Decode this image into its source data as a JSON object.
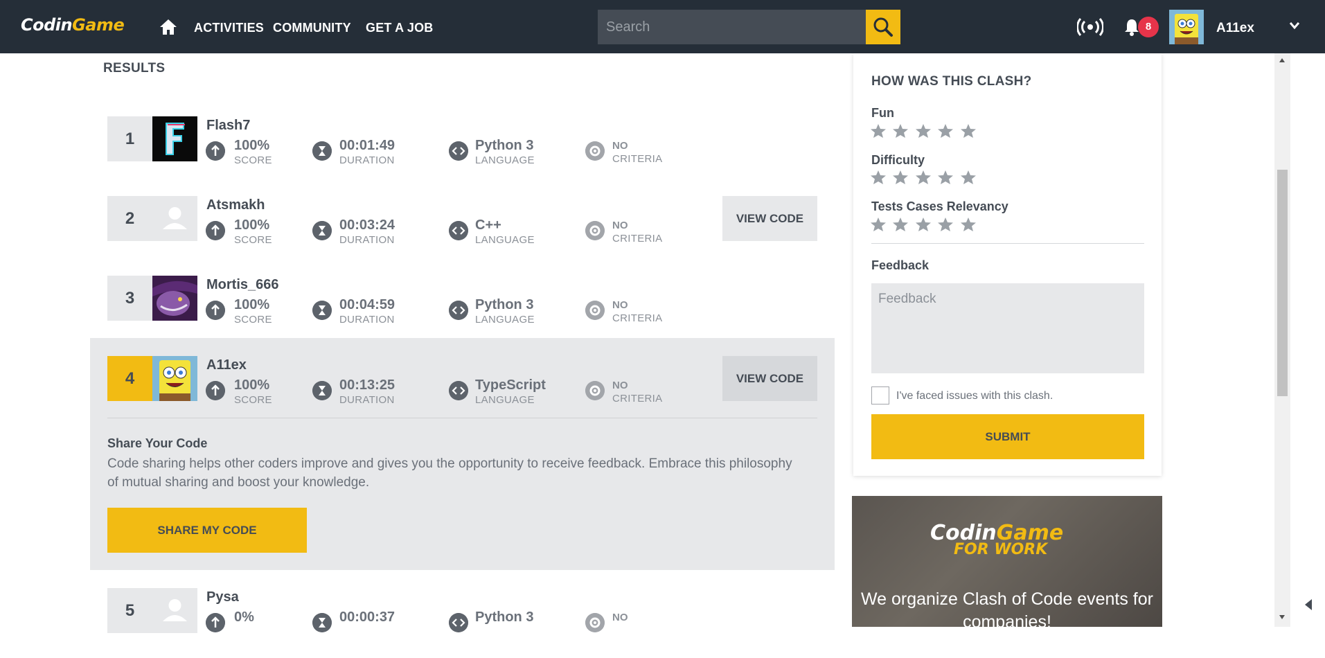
{
  "header": {
    "logo_main": "Codin",
    "logo_accent": "Game",
    "nav": [
      "ACTIVITIES",
      "COMMUNITY",
      "GET A JOB"
    ],
    "search_placeholder": "Search",
    "notifications_count": "8",
    "username": "A11ex"
  },
  "results": {
    "title": "RESULTS",
    "rows": [
      {
        "rank": "1",
        "name": "Flash7",
        "score": "100%",
        "score_label": "SCORE",
        "duration": "00:01:49",
        "duration_label": "DURATION",
        "language": "Python 3",
        "language_label": "LANGUAGE",
        "criteria": "NO",
        "criteria_label": "CRITERIA"
      },
      {
        "rank": "2",
        "name": "Atsmakh",
        "score": "100%",
        "score_label": "SCORE",
        "duration": "00:03:24",
        "duration_label": "DURATION",
        "language": "C++",
        "language_label": "LANGUAGE",
        "criteria": "NO",
        "criteria_label": "CRITERIA",
        "action": "VIEW CODE"
      },
      {
        "rank": "3",
        "name": "Mortis_666",
        "score": "100%",
        "score_label": "SCORE",
        "duration": "00:04:59",
        "duration_label": "DURATION",
        "language": "Python 3",
        "language_label": "LANGUAGE",
        "criteria": "NO",
        "criteria_label": "CRITERIA"
      },
      {
        "rank": "4",
        "name": "A11ex",
        "score": "100%",
        "score_label": "SCORE",
        "duration": "00:13:25",
        "duration_label": "DURATION",
        "language": "TypeScript",
        "language_label": "LANGUAGE",
        "criteria": "NO",
        "criteria_label": "CRITERIA",
        "action": "VIEW CODE"
      },
      {
        "rank": "5",
        "name": "Pysa",
        "score": "0%",
        "duration": "00:00:37",
        "language": "Python 3",
        "criteria": "NO"
      }
    ]
  },
  "share": {
    "title": "Share Your Code",
    "text": "Code sharing helps other coders improve and gives you the opportunity to receive feedback. Embrace this philosophy of mutual sharing and boost your knowledge.",
    "button": "SHARE MY CODE"
  },
  "feedback": {
    "title": "HOW WAS THIS CLASH?",
    "ratings": [
      {
        "label": "Fun",
        "stars": 0
      },
      {
        "label": "Difficulty",
        "stars": 0
      },
      {
        "label": "Tests Cases Relevancy",
        "stars": 0
      }
    ],
    "feedback_label": "Feedback",
    "feedback_placeholder": "Feedback",
    "checkbox_label": "I've faced issues with this clash.",
    "submit": "SUBMIT"
  },
  "promo": {
    "logo_main": "Codin",
    "logo_accent": "Game",
    "subtitle": "FOR WORK",
    "text": "We organize Clash of Code events for companies!"
  },
  "colors": {
    "accent": "#f2bb13",
    "header_bg": "#252e38",
    "badge": "#e6344a"
  }
}
